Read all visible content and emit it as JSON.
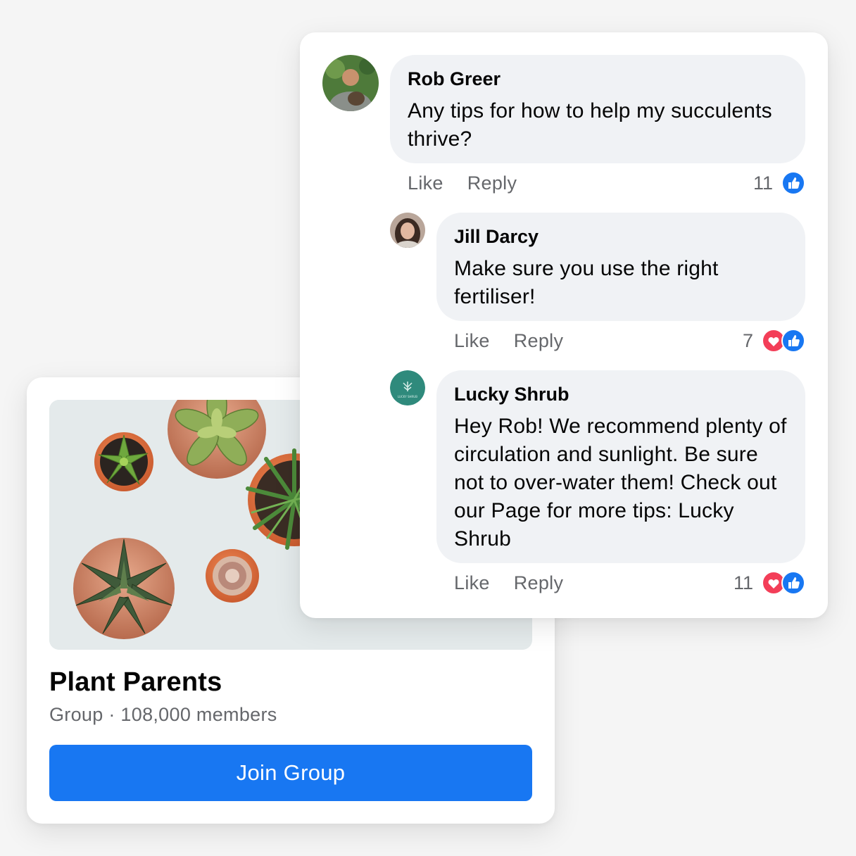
{
  "group": {
    "name": "Plant Parents",
    "meta": "Group · 108,000 members",
    "join_label": "Join Group"
  },
  "comments": [
    {
      "author": "Rob Greer",
      "text": "Any tips for how to help my succulents thrive?",
      "like_label": "Like",
      "reply_label": "Reply",
      "reaction_count": "11",
      "reactions": [
        "like-icon"
      ]
    },
    {
      "author": "Jill Darcy",
      "text": "Make sure you use the right fertiliser!",
      "like_label": "Like",
      "reply_label": "Reply",
      "reaction_count": "7",
      "reactions": [
        "love-icon",
        "like-icon"
      ]
    },
    {
      "author": "Lucky Shrub",
      "avatar_text": "LUCKY SHRUB",
      "text": "Hey Rob! We recommend plenty of circulation and sunlight. Be sure not to over-water them! Check out our Page for more tips: Lucky Shrub",
      "like_label": "Like",
      "reply_label": "Reply",
      "reaction_count": "11",
      "reactions": [
        "love-icon",
        "like-icon"
      ]
    }
  ],
  "colors": {
    "accent": "#1877f2",
    "bubble": "#f0f2f5",
    "secondary_text": "#65676b",
    "love": "#f33e58",
    "brand_avatar": "#2f8a7c"
  }
}
